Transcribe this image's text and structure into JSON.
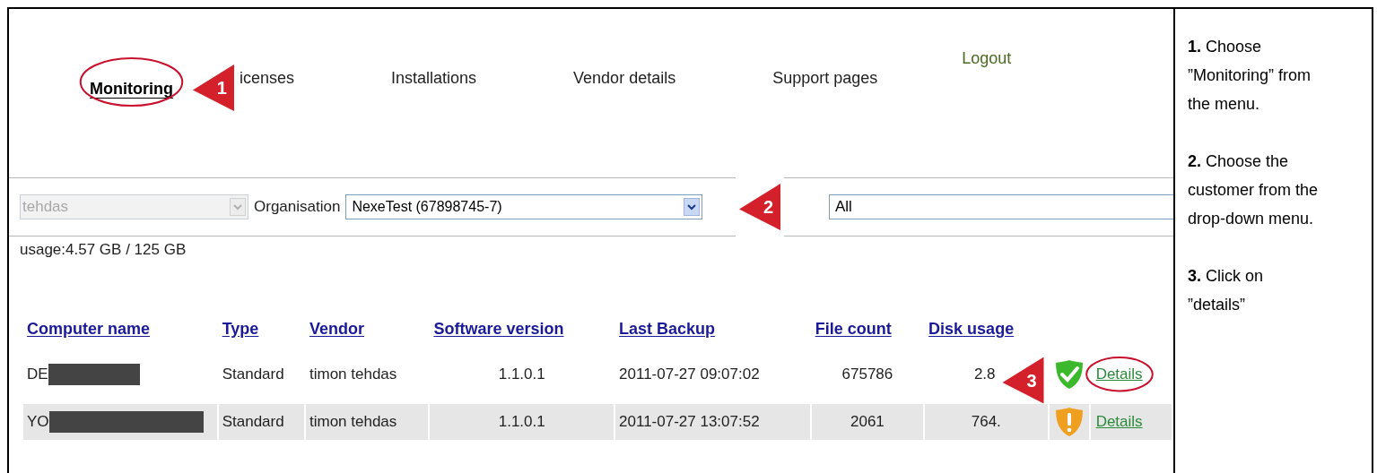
{
  "nav": {
    "items": [
      {
        "label": "Monitoring",
        "selected": true,
        "circled": true
      },
      {
        "label": "icenses",
        "selected": false,
        "circled": false
      },
      {
        "label": "Installations",
        "selected": false,
        "circled": false
      },
      {
        "label": "Vendor details",
        "selected": false,
        "circled": false
      },
      {
        "label": "Support pages",
        "selected": false,
        "circled": false
      }
    ],
    "logout": "Logout"
  },
  "filters": {
    "vendor_select": {
      "value": "tehdas",
      "disabled": true
    },
    "organisation_label": "Organisation",
    "organisation_select": {
      "value": "NexeTest (67898745-7)",
      "disabled": false
    },
    "filter_3": {
      "value": "All"
    }
  },
  "usage": "usage:4.57 GB / 125 GB",
  "table": {
    "columns": [
      "Computer name",
      "Type",
      "Vendor",
      "Software version",
      "Last Backup",
      "File count",
      "Disk usage"
    ],
    "rows": [
      {
        "computer_name": "DE",
        "type": "Standard",
        "vendor": "timon tehdas",
        "software_version": "1.1.0.1",
        "last_backup": "2011-07-27 09:07:02",
        "file_count": "675786",
        "disk_usage": "2.8",
        "kind": "ok",
        "shaded": false,
        "link": "Details",
        "circled": true
      },
      {
        "computer_name": "YO",
        "type": "Standard",
        "vendor": "timon tehdas",
        "software_version": "1.1.0.1",
        "last_backup": "2011-07-27 13:07:52",
        "file_count": "2061",
        "disk_usage": "764.",
        "kind": "warning",
        "shaded": true,
        "link": "Details",
        "circled": false
      }
    ]
  },
  "markers": [
    "1",
    "2",
    "3"
  ],
  "instructions": [
    "**1.** Choose ”Monitoring” from the menu.",
    "**2.** Choose the customer from the drop-down menu.",
    "**3.** Click on ”details”"
  ]
}
